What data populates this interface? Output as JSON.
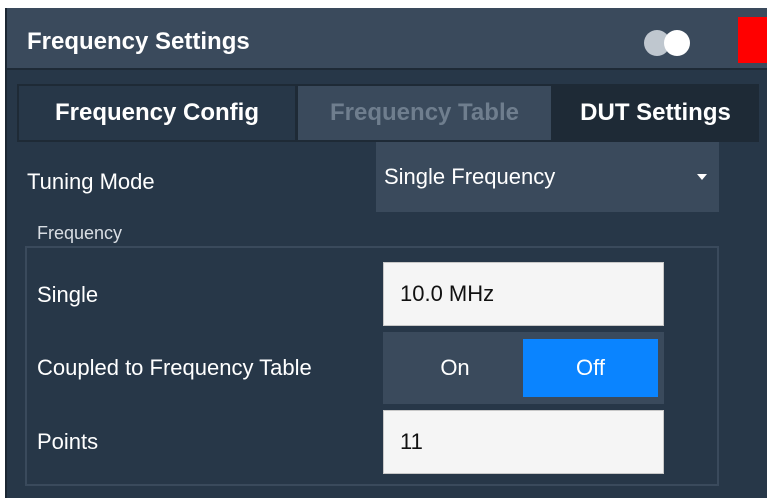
{
  "dialog": {
    "title": "Frequency Settings",
    "icons": {
      "toggle": "toggle-circles-icon",
      "close": "close-box-icon"
    },
    "colors": {
      "background": "#273748",
      "panel": "#3a4a5c",
      "accent": "#0a84ff",
      "close": "#ff0000"
    }
  },
  "tabs": [
    {
      "label": "Frequency Config",
      "state": "active"
    },
    {
      "label": "Frequency Table",
      "state": "disabled"
    },
    {
      "label": "DUT Settings",
      "state": "inactive"
    }
  ],
  "tuning_mode": {
    "label": "Tuning Mode",
    "value": "Single Frequency"
  },
  "frequency_group": {
    "label": "Frequency",
    "single": {
      "label": "Single",
      "value": "10.0 MHz"
    },
    "coupled": {
      "label": "Coupled to Frequency Table",
      "options": [
        "On",
        "Off"
      ],
      "selected": "Off"
    },
    "points": {
      "label": "Points",
      "value": "11"
    }
  }
}
